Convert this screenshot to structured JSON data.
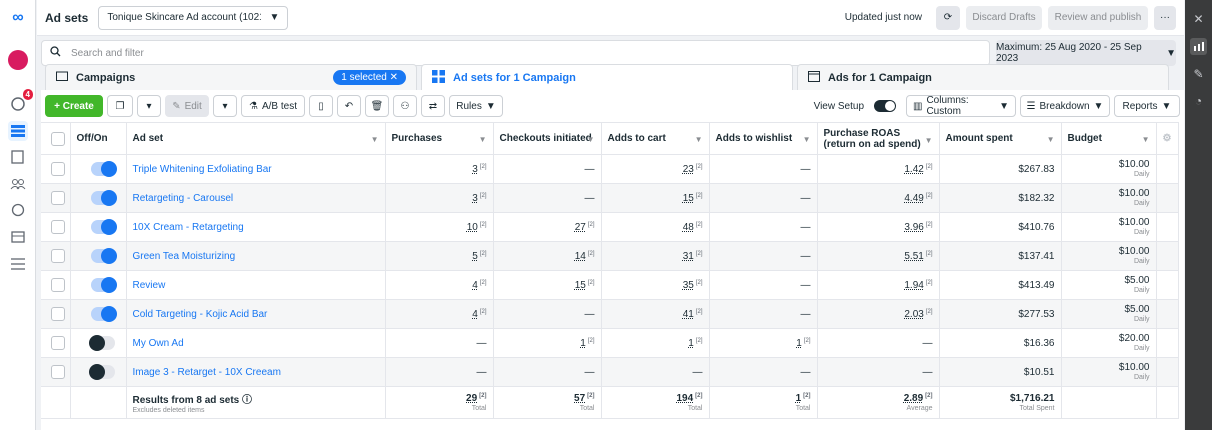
{
  "header": {
    "title": "Ad sets",
    "account": "Tonique Skincare Ad account (102117...",
    "updated": "Updated just now",
    "discard": "Discard Drafts",
    "review": "Review and publish",
    "more": "···"
  },
  "search": {
    "placeholder": "Search and filter",
    "date_range": "Maximum: 25 Aug 2020 - 25 Sep 2023"
  },
  "tabs": {
    "campaigns": "Campaigns",
    "selected": "1 selected",
    "adsets": "Ad sets for 1 Campaign",
    "ads": "Ads for 1 Campaign"
  },
  "toolbar": {
    "create": "+ Create",
    "edit": "Edit",
    "abtest": "A/B test",
    "rules": "Rules",
    "view_setup": "View Setup",
    "columns": "Columns: Custom",
    "breakdown": "Breakdown",
    "reports": "Reports"
  },
  "rail": {
    "notifications": "4"
  },
  "columns": [
    "Off/On",
    "Ad set",
    "Purchases",
    "Checkouts initiated",
    "Adds to cart",
    "Adds to wishlist",
    "Purchase ROAS (return on ad spend)",
    "Amount spent",
    "Budget"
  ],
  "rows": [
    {
      "on": true,
      "name": "Triple Whitening Exfoliating Bar",
      "purchases": "3",
      "checkouts": "—",
      "cart": "23",
      "wishlist": "—",
      "roas": "1.42",
      "spent": "$267.83",
      "budget": "$10.00",
      "period": "Daily"
    },
    {
      "on": true,
      "name": "Retargeting - Carousel",
      "purchases": "3",
      "checkouts": "—",
      "cart": "15",
      "wishlist": "—",
      "roas": "4.49",
      "spent": "$182.32",
      "budget": "$10.00",
      "period": "Daily"
    },
    {
      "on": true,
      "name": "10X Cream - Retargeting",
      "purchases": "10",
      "checkouts": "27",
      "cart": "48",
      "wishlist": "—",
      "roas": "3.96",
      "spent": "$410.76",
      "budget": "$10.00",
      "period": "Daily"
    },
    {
      "on": true,
      "name": "Green Tea Moisturizing",
      "purchases": "5",
      "checkouts": "14",
      "cart": "31",
      "wishlist": "—",
      "roas": "5.51",
      "spent": "$137.41",
      "budget": "$10.00",
      "period": "Daily"
    },
    {
      "on": true,
      "name": "Review",
      "purchases": "4",
      "checkouts": "15",
      "cart": "35",
      "wishlist": "—",
      "roas": "1.94",
      "spent": "$413.49",
      "budget": "$5.00",
      "period": "Daily"
    },
    {
      "on": true,
      "name": "Cold Targeting - Kojic Acid Bar",
      "purchases": "4",
      "checkouts": "—",
      "cart": "41",
      "wishlist": "—",
      "roas": "2.03",
      "spent": "$277.53",
      "budget": "$5.00",
      "period": "Daily"
    },
    {
      "on": false,
      "name": "My Own Ad",
      "purchases": "—",
      "checkouts": "1",
      "cart": "1",
      "wishlist": "1",
      "roas": "—",
      "spent": "$16.36",
      "budget": "$20.00",
      "period": "Daily"
    },
    {
      "on": false,
      "name": "Image 3 - Retarget - 10X Creeam",
      "purchases": "—",
      "checkouts": "—",
      "cart": "—",
      "wishlist": "—",
      "roas": "—",
      "spent": "$10.51",
      "budget": "$10.00",
      "period": "Daily"
    }
  ],
  "footer": {
    "label": "Results from 8 ad sets",
    "note": "Excludes deleted items",
    "purchases": "29",
    "purchases_sub": "Total",
    "checkouts": "57",
    "checkouts_sub": "Total",
    "cart": "194",
    "cart_sub": "Total",
    "wishlist": "1",
    "wishlist_sub": "Total",
    "roas": "2.89",
    "roas_sub": "Average",
    "spent": "$1,716.21",
    "spent_sub": "Total Spent"
  }
}
